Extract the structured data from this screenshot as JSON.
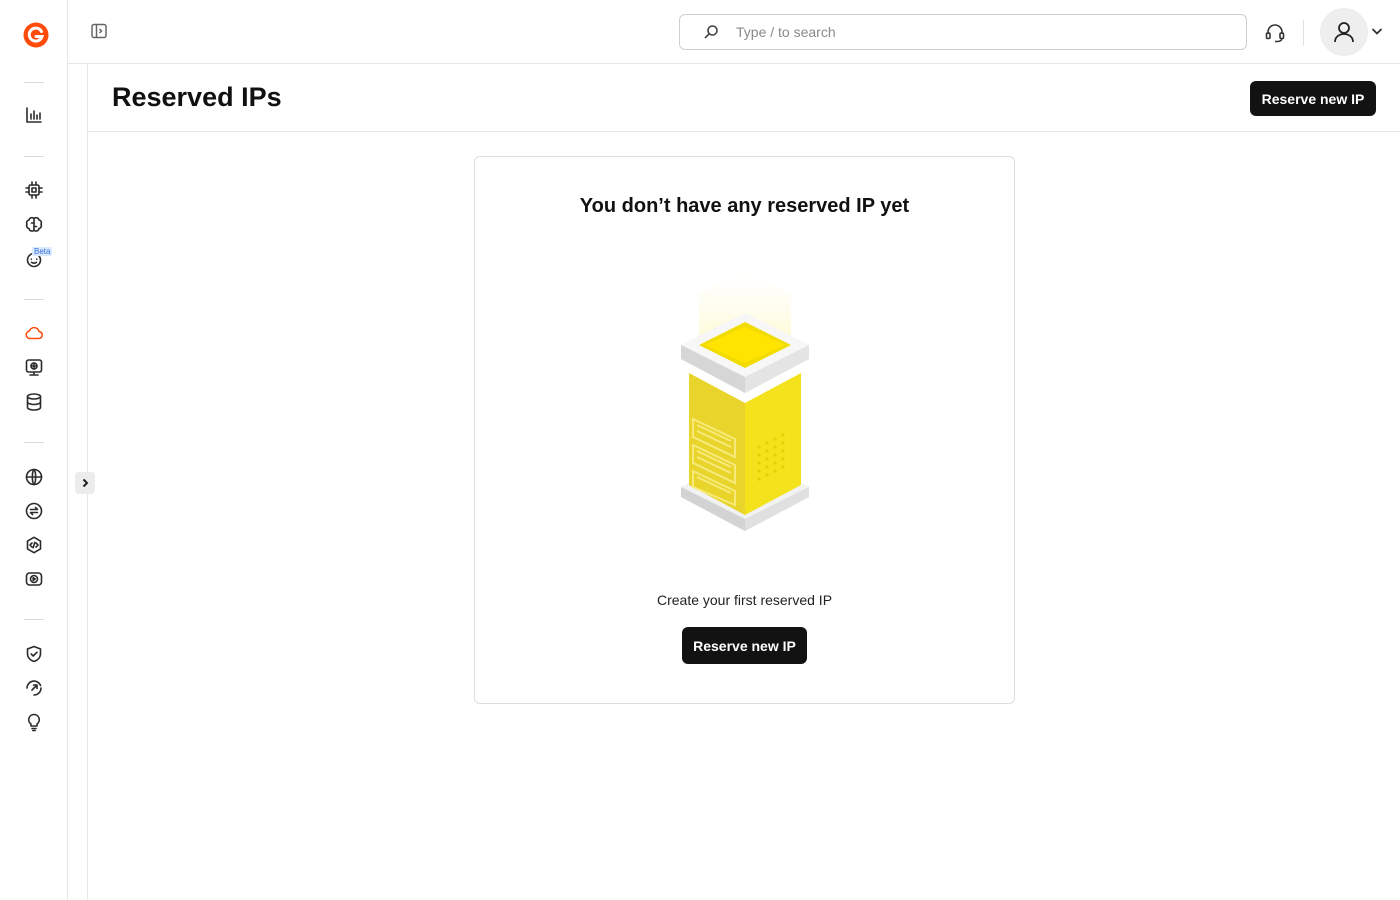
{
  "topbar": {
    "search_placeholder": "Type / to search"
  },
  "page": {
    "title": "Reserved IPs",
    "header_button_label": "Reserve new IP"
  },
  "empty_state": {
    "title": "You don’t have any reserved IP yet",
    "subtitle": "Create your first reserved IP",
    "button_label": "Reserve new IP"
  },
  "sidebar": {
    "beta_badge": "Beta",
    "active_item": "cloud-icon",
    "icons": [
      "analytics-icon",
      "chip-icon",
      "brain-icon",
      "robot-icon",
      "cloud-icon",
      "server-icon",
      "database-icon",
      "globe-icon",
      "transfer-icon",
      "code-icon",
      "video-icon",
      "shield-check-icon",
      "fingerprint-icon",
      "lightbulb-icon"
    ]
  },
  "colors": {
    "brand_accent": "#ff4c0d",
    "button_dark": "#121212",
    "illustration_yellow": "#f7e11a"
  }
}
